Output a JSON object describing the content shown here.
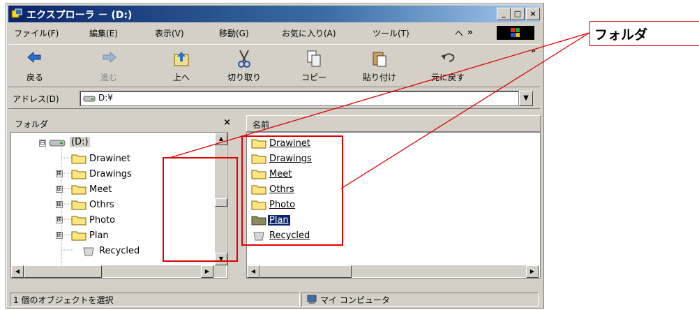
{
  "window": {
    "title": "エクスプローラ － (D:)",
    "buttons": {
      "minimize": "_",
      "maximize": "□",
      "close": "×"
    }
  },
  "menu": {
    "items": [
      "ファイル(F)",
      "編集(E)",
      "表示(V)",
      "移動(G)",
      "お気に入り(A)",
      "ツール(T)",
      "ヘ",
      "»"
    ]
  },
  "toolbar": {
    "back": "戻る",
    "forward": "進む",
    "up": "上へ",
    "cut": "切り取り",
    "copy": "コピー",
    "paste": "貼り付け",
    "undo": "元に戻す",
    "more": "»"
  },
  "address": {
    "label": "アドレス(D)",
    "value": "D:¥"
  },
  "folders_pane": {
    "title": "フォルダ",
    "close": "×",
    "tree": [
      {
        "label": "(D:)",
        "expander": "⊟"
      },
      {
        "label": "Drawinet",
        "expander": ""
      },
      {
        "label": "Drawings",
        "expander": "⊞"
      },
      {
        "label": "Meet",
        "expander": "⊞"
      },
      {
        "label": "Othrs",
        "expander": "⊞"
      },
      {
        "label": "Photo",
        "expander": "⊞"
      },
      {
        "label": "Plan",
        "expander": "⊞"
      },
      {
        "label": "Recycled",
        "expander": ""
      }
    ]
  },
  "file_list": {
    "column_name": "名前",
    "items": [
      "Drawinet",
      "Drawings",
      "Meet",
      "Othrs",
      "Photo",
      "Plan",
      "Recycled"
    ],
    "selected": "Plan"
  },
  "status": {
    "left": "1 個のオブジェクトを選択",
    "right": "マイ コンピュータ"
  },
  "annotation": {
    "label": "フォルダ",
    "color": "#e00000"
  }
}
